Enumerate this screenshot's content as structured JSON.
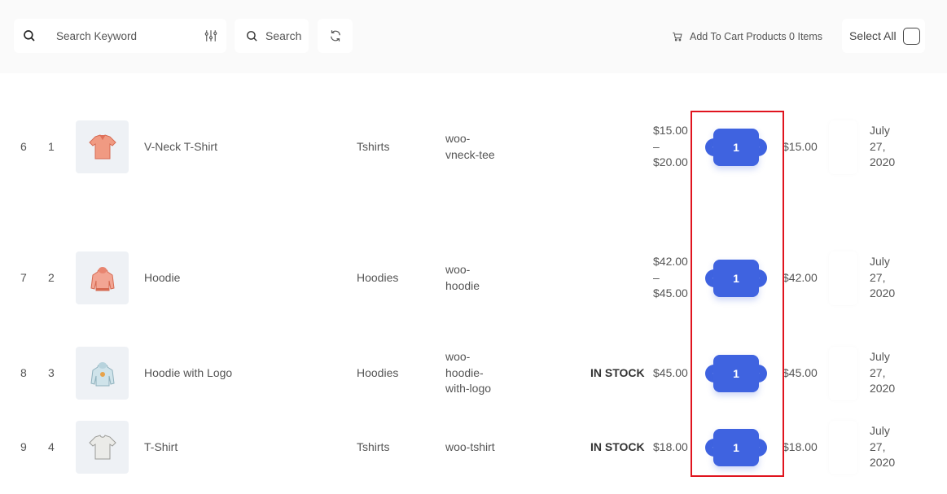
{
  "toolbar": {
    "search_placeholder": "Search Keyword",
    "search_icon": "search-icon",
    "filter_icon": "sliders-icon",
    "search_button_label": "Search",
    "refresh_icon": "refresh-icon",
    "cart_icon": "cart-icon",
    "cart_text": "Add To Cart Products 0 Items",
    "select_all_label": "Select All"
  },
  "products": [
    {
      "row_number": "6",
      "index": "1",
      "name": "V-Neck T-Shirt",
      "category": "Tshirts",
      "sku": "woo-vneck-tee",
      "stock": "",
      "price": "$15.00 – $20.00",
      "quantity": "1",
      "total": "$15.00",
      "date": "July 27, 2020",
      "image": "vneck-tshirt-image"
    },
    {
      "row_number": "7",
      "index": "2",
      "name": "Hoodie",
      "category": "Hoodies",
      "sku": "woo-hoodie",
      "stock": "",
      "price": "$42.00 – $45.00",
      "quantity": "1",
      "total": "$42.00",
      "date": "July 27, 2020",
      "image": "hoodie-image"
    },
    {
      "row_number": "8",
      "index": "3",
      "name": "Hoodie with Logo",
      "category": "Hoodies",
      "sku": "woo-hoodie-with-logo",
      "stock": "IN STOCK",
      "price": "$45.00",
      "quantity": "1",
      "total": "$45.00",
      "date": "July 27, 2020",
      "image": "hoodie-with-logo-image"
    },
    {
      "row_number": "9",
      "index": "4",
      "name": "T-Shirt",
      "category": "Tshirts",
      "sku": "woo-tshirt",
      "stock": "IN STOCK",
      "price": "$18.00",
      "quantity": "1",
      "total": "$18.00",
      "date": "July 27, 2020",
      "image": "tshirt-image"
    }
  ],
  "quantity_controls": {
    "decrement_glyph": "‹",
    "increment_glyph": "›"
  },
  "colors": {
    "accent": "#3f63e0",
    "highlight_border": "#e0141e",
    "thumb_bg": "#eef1f5"
  }
}
